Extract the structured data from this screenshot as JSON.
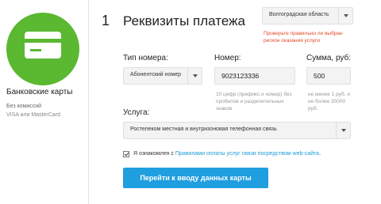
{
  "sidebar": {
    "title": "Банковские карты",
    "sub1": "Без комиссий",
    "sub2": "VISA или MasterCard",
    "icon": "credit-card-icon",
    "accent": "#5bb831"
  },
  "header": {
    "step_number": "1",
    "title": "Реквизиты платежа"
  },
  "region": {
    "value": "Волгоградская область",
    "warning": "Проверьте правильно ли выбран регион оказания услуги"
  },
  "form": {
    "type_label": "Тип номера:",
    "type_value": "Абонентский номер",
    "number_label": "Номер:",
    "number_value": "9023123336",
    "number_hint": "10 цифр (префикс и номер) без пробелов и разделительных знаков",
    "sum_label": "Сумма, руб:",
    "sum_value": "500",
    "sum_hint": "не менее 1 руб. и не более 30000 руб.",
    "service_label": "Услуга:",
    "service_value": "Ростелеком местная и внутризоновая телефонная связь"
  },
  "agreement": {
    "checked": true,
    "prefix": "Я ознакомлен с ",
    "link": "Правилами оплаты услуг связи посредством web-сайта",
    "suffix": "."
  },
  "submit_label": "Перейти к вводу данных карты",
  "colors": {
    "button": "#1f9ee0",
    "link": "#1a9bd6",
    "warning": "#e24a2a"
  }
}
